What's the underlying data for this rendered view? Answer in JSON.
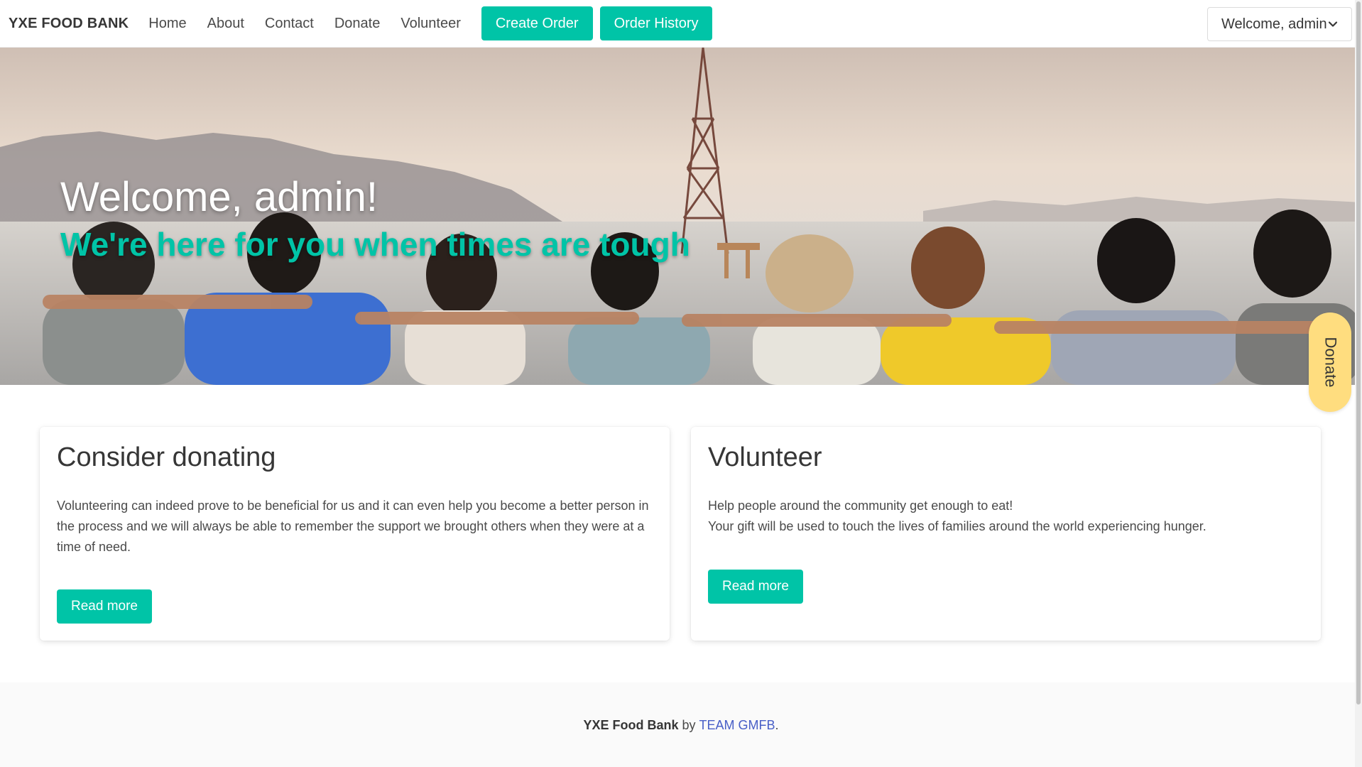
{
  "nav": {
    "brand": "YXE FOOD BANK",
    "links": [
      "Home",
      "About",
      "Contact",
      "Donate",
      "Volunteer"
    ],
    "create_order": "Create Order",
    "order_history": "Order History",
    "user_menu": "Welcome, admin"
  },
  "hero": {
    "title": "Welcome, admin!",
    "subtitle": "We're here for you when times are tough"
  },
  "floating_tab": {
    "label": "Donate"
  },
  "cards": [
    {
      "title": "Consider donating",
      "body": "Volunteering can indeed prove to be beneficial for us and it can even help you become a better person in the process and we will always be able to remember the support we brought others when they were at a time of need.",
      "button": "Read more"
    },
    {
      "title": "Volunteer",
      "body_line1": "Help people around the community get enough to eat!",
      "body_line2": "Your gift will be used to touch the lives of families around the world experiencing hunger.",
      "button": "Read more"
    }
  ],
  "footer": {
    "name": "YXE Food Bank",
    "by": "by",
    "team": "TEAM GMFB",
    "period": "."
  },
  "colors": {
    "accent": "#00c4a7",
    "float_tab": "#ffdd7f",
    "link": "#485fc7"
  }
}
